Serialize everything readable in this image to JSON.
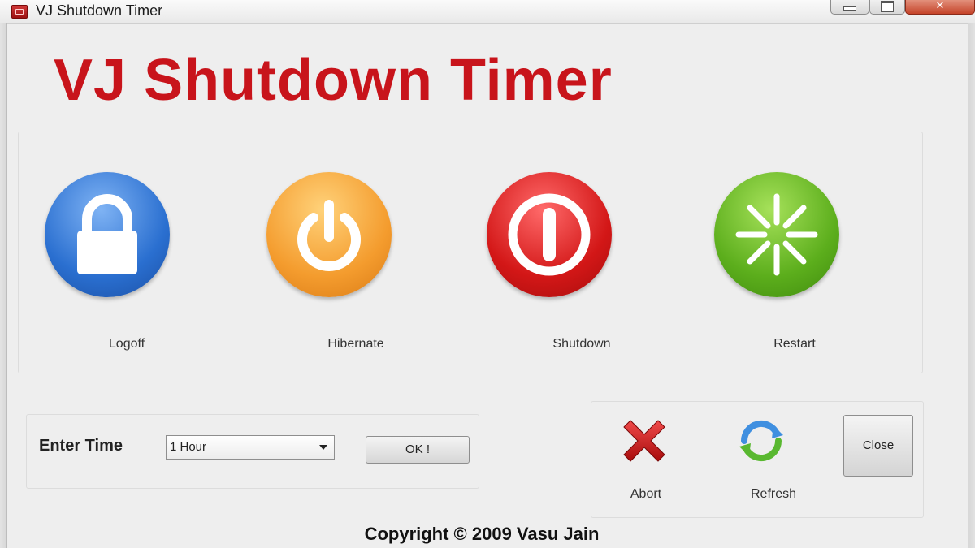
{
  "window": {
    "title": "VJ Shutdown Timer"
  },
  "header": {
    "title": "VJ Shutdown Timer",
    "title_color": "#c8141b"
  },
  "actions": [
    {
      "label": "Logoff",
      "icon": "lock-icon",
      "color": "#2a6fd0"
    },
    {
      "label": "Hibernate",
      "icon": "power-icon",
      "color": "#f49c2e"
    },
    {
      "label": "Shutdown",
      "icon": "shutdown-icon",
      "color": "#d31717"
    },
    {
      "label": "Restart",
      "icon": "restart-icon",
      "color": "#5cae1c"
    }
  ],
  "timer": {
    "label": "Enter Time",
    "selected": "1 Hour",
    "ok_label": "OK !"
  },
  "controls": {
    "abort_label": "Abort",
    "refresh_label": "Refresh",
    "close_label": "Close"
  },
  "footer": {
    "copyright": "Copyright © 2009 Vasu Jain"
  }
}
